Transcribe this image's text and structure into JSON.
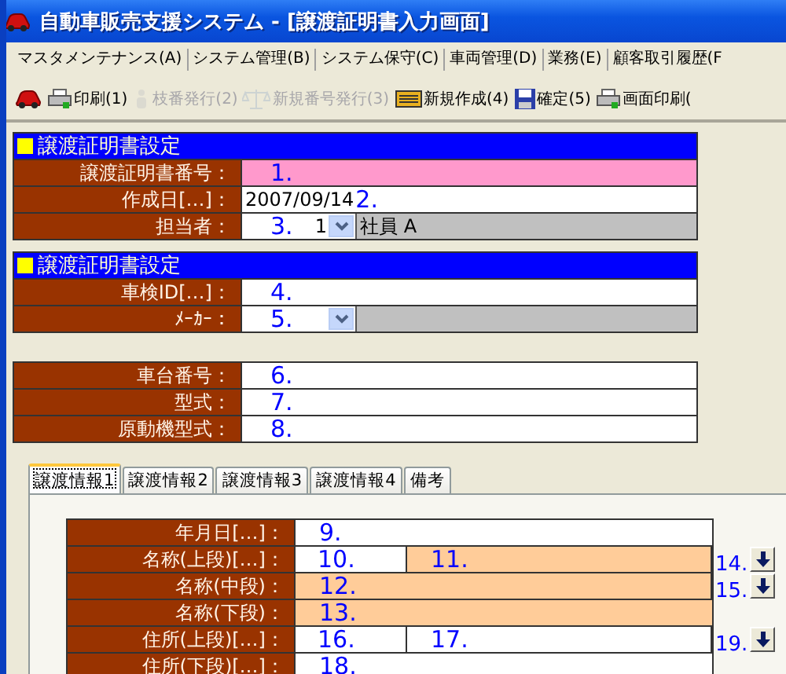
{
  "window": {
    "title": "自動車販売支援システム - [譲渡証明書入力画面]"
  },
  "menu": [
    "マスタメンテナンス(A)",
    "システム管理(B)",
    "システム保守(C)",
    "車両管理(D)",
    "業務(E)",
    "顧客取引履歴(F"
  ],
  "toolbar": [
    {
      "kind": "car",
      "disabled": false
    },
    {
      "kind": "printer",
      "label": "印刷(1)",
      "disabled": false
    },
    {
      "kind": "figure",
      "label": "枝番発行(2)",
      "disabled": true
    },
    {
      "kind": "scales",
      "label": "新規番号発行(3)",
      "disabled": true
    },
    {
      "kind": "keyboard",
      "label": "新規作成(4)",
      "disabled": false
    },
    {
      "kind": "floppy",
      "label": "確定(5)",
      "disabled": false
    },
    {
      "kind": "printer",
      "label": "画面印刷(",
      "disabled": false
    }
  ],
  "sections": [
    {
      "title": "譲渡証明書設定",
      "rows": [
        {
          "kind": "text",
          "label": "譲渡証明書番号：",
          "note": "1.",
          "color": "#ff99cc"
        },
        {
          "kind": "date",
          "label": "作成日[…]：",
          "value": "2007/09/14",
          "note": "2.",
          "color": "#ffffff"
        },
        {
          "kind": "select",
          "label": "担当者：",
          "note": "3.",
          "value": "1",
          "extra": "社員 A",
          "color": "#ffffff"
        }
      ]
    },
    {
      "title": "譲渡証明書設定",
      "rows": [
        {
          "kind": "text",
          "label": "車検ID[…]：",
          "note": "4.",
          "color": "#ffffff"
        },
        {
          "kind": "select",
          "label": "ﾒｰｶｰ：",
          "note": "5.",
          "color": "#ffffff"
        }
      ]
    },
    {
      "rows": [
        {
          "kind": "text",
          "label": "車台番号：",
          "note": "6.",
          "color": "#ffffff"
        },
        {
          "kind": "text",
          "label": "型式：",
          "note": "7.",
          "color": "#ffffff"
        },
        {
          "kind": "text",
          "label": "原動機型式：",
          "note": "8.",
          "color": "#ffffff"
        }
      ]
    }
  ],
  "tabs": [
    {
      "label": "譲渡情報1",
      "selected": true
    },
    {
      "label": "譲渡情報2",
      "selected": false
    },
    {
      "label": "譲渡情報3",
      "selected": false
    },
    {
      "label": "譲渡情報4",
      "selected": false
    },
    {
      "label": "備考",
      "selected": false
    }
  ],
  "panel_rows": [
    {
      "label": "年月日[…]：",
      "cells": [
        {
          "text": "9.",
          "color": "#ffffff"
        }
      ]
    },
    {
      "label": "名称(上段)[…]：",
      "cells": [
        {
          "text": "10.",
          "color": "#ffffff"
        },
        {
          "text": "11.",
          "color": "#ffcc99"
        }
      ],
      "side": {
        "note": "14.",
        "button": true
      }
    },
    {
      "label": "名称(中段)：",
      "cells": [
        {
          "text": "12.",
          "color": "#ffcc99"
        }
      ],
      "side": {
        "note": "15.",
        "button": true
      }
    },
    {
      "label": "名称(下段)：",
      "cells": [
        {
          "text": "13.",
          "color": "#ffcc99"
        }
      ]
    },
    {
      "label": "住所(上段)[…]：",
      "cells": [
        {
          "text": "16.",
          "color": "#ffffff"
        },
        {
          "text": "17.",
          "color": "#ffffff"
        }
      ],
      "side": {
        "note": "19.",
        "button": true
      }
    },
    {
      "label": "住所(下段)[…]：",
      "cells": [
        {
          "text": "18.",
          "color": "#ffffff"
        }
      ]
    }
  ]
}
